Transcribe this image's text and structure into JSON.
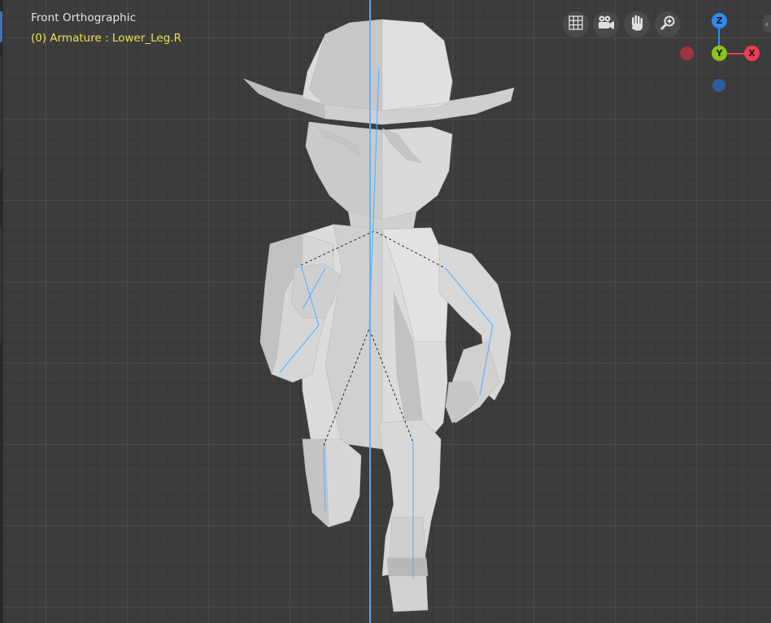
{
  "viewport": {
    "view_name": "Front Orthographic",
    "active_object": "(0) Armature : Lower_Leg.R"
  },
  "toolbar": {
    "buttons": [
      {
        "name": "toggle-grid-view",
        "icon": "grid-icon"
      },
      {
        "name": "toggle-camera-view",
        "icon": "camera-icon"
      },
      {
        "name": "pan-view",
        "icon": "hand-icon"
      },
      {
        "name": "zoom-view",
        "icon": "magnifier-icon"
      }
    ]
  },
  "gizmo": {
    "z_label": "Z",
    "y_label": "Y",
    "x_label": "X",
    "z_color": "#2f8cf0",
    "y_color": "#8bc418",
    "x_color": "#f13a53",
    "neg_x_color": "#9e3445",
    "neg_z_color": "#2e5e9e"
  },
  "colors": {
    "background": "#3d3d3d",
    "mesh": "#d6d6d6",
    "bone": "#5ab0ff",
    "header_text": "#e6e6e6",
    "object_text": "#e9e24a"
  }
}
